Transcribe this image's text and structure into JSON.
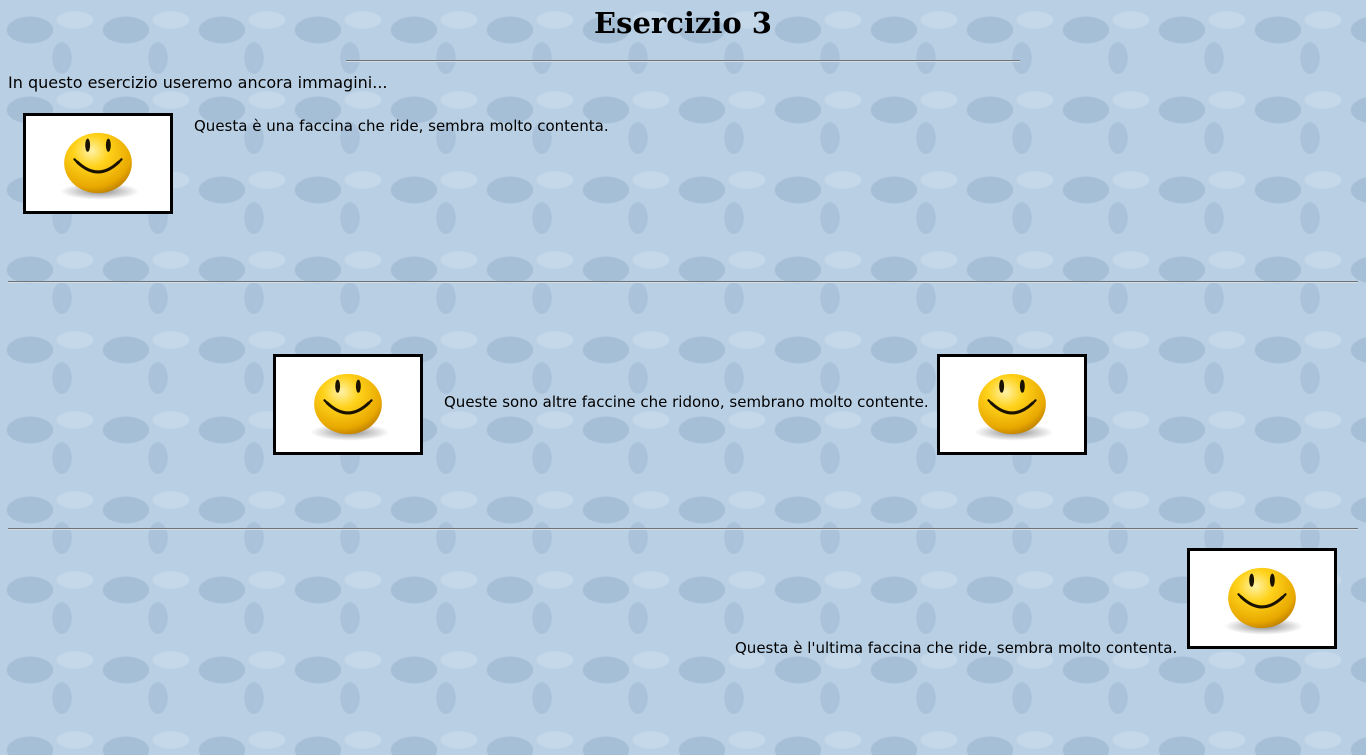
{
  "page": {
    "title": "Esercizio 3",
    "intro": "In questo esercizio useremo ancora immagini..."
  },
  "sections": [
    {
      "caption": "Questa è una faccina che ride, sembra molto contenta."
    },
    {
      "caption": "Queste sono altre faccine che ridono, sembrano molto contente."
    },
    {
      "caption": "Questa è l'ultima faccina che ride, sembra molto contenta."
    }
  ],
  "icons": {
    "smiley": "smiley-face-icon"
  },
  "colors": {
    "background": "#b9cfe3",
    "smiley_yellow": "#f6c400",
    "frame": "#000000"
  }
}
